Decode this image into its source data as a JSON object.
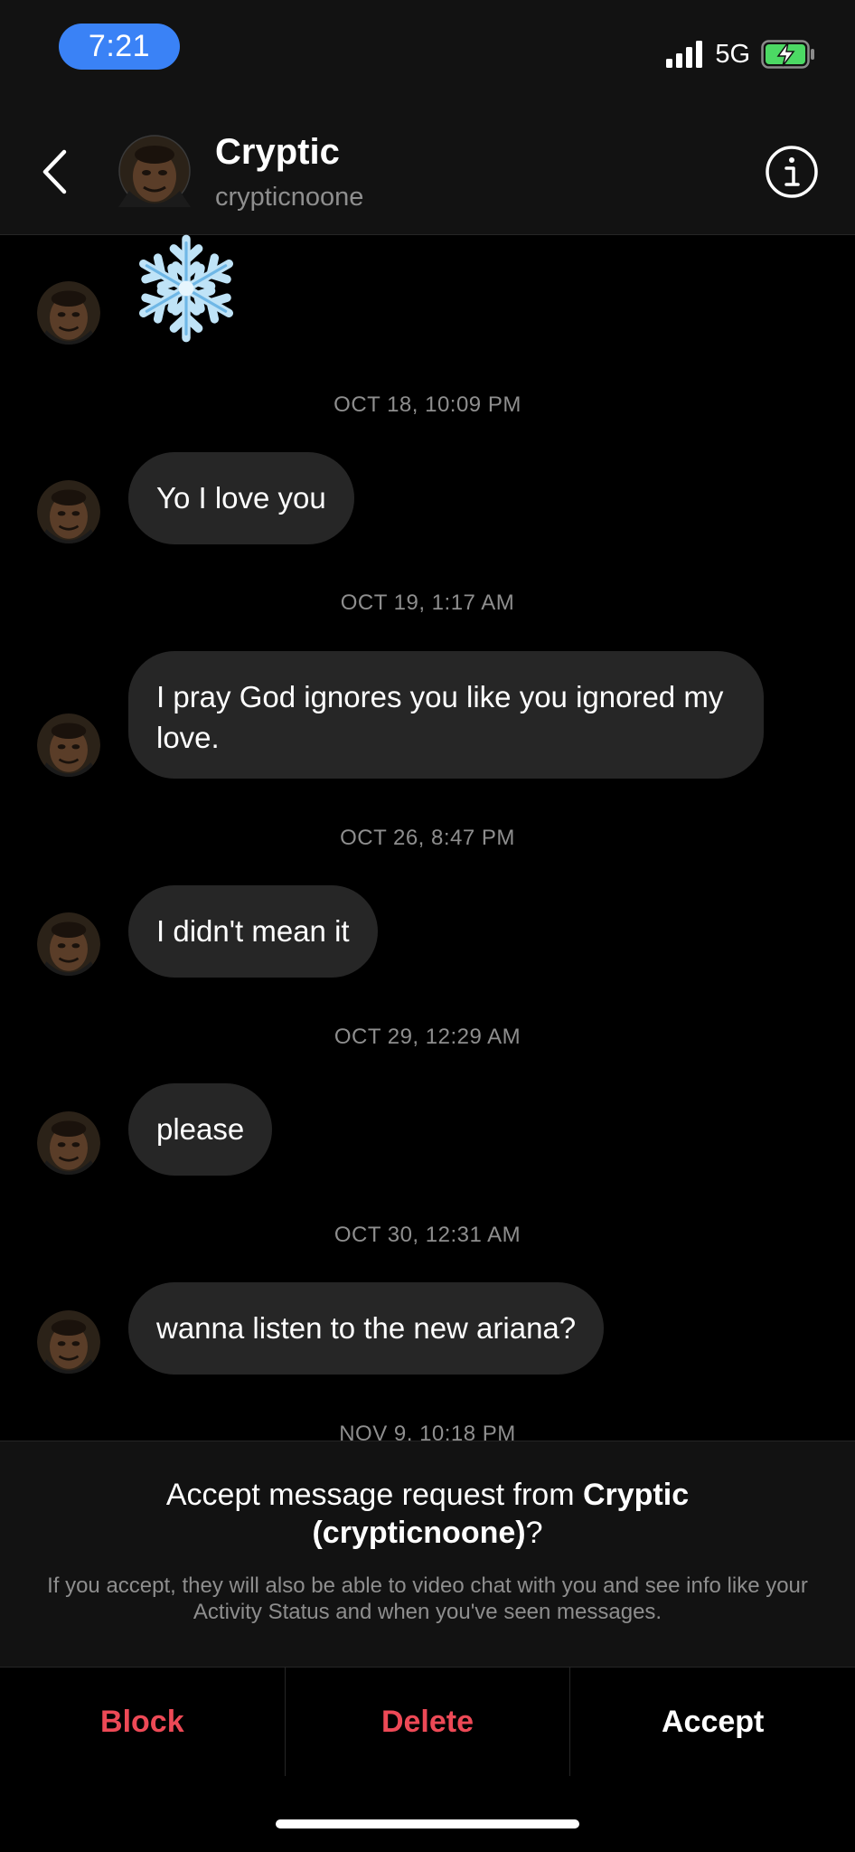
{
  "status_bar": {
    "time": "7:21",
    "network": "5G",
    "time_pill_color": "#3a82f6",
    "battery_color": "#4cd964"
  },
  "header": {
    "name": "Cryptic",
    "username": "crypticnoone"
  },
  "messages": [
    {
      "type": "sticker",
      "icon": "snowflake-icon"
    },
    {
      "timestamp": "OCT 18, 10:09 PM",
      "text": "Yo I love you"
    },
    {
      "timestamp": "OCT 19, 1:17 AM",
      "text": "I pray God ignores you like you ignored my love."
    },
    {
      "timestamp": "OCT 26, 8:47 PM",
      "text": "I didn't mean it"
    },
    {
      "timestamp": "OCT 29, 12:29 AM",
      "text": "please"
    },
    {
      "timestamp": "OCT 30, 12:31 AM",
      "text": "wanna listen to the new ariana?"
    },
    {
      "timestamp": "NOV 9, 10:18 PM"
    }
  ],
  "request": {
    "prefix": "Accept message request from ",
    "name": "Cryptic",
    "username_display": "(crypticnoone)",
    "suffix": "?",
    "note": "If you accept, they will also be able to video chat with you and see info like your Activity Status and when you've seen messages."
  },
  "actions": {
    "block": "Block",
    "delete": "Delete",
    "accept": "Accept",
    "danger_color": "#ed4956"
  }
}
